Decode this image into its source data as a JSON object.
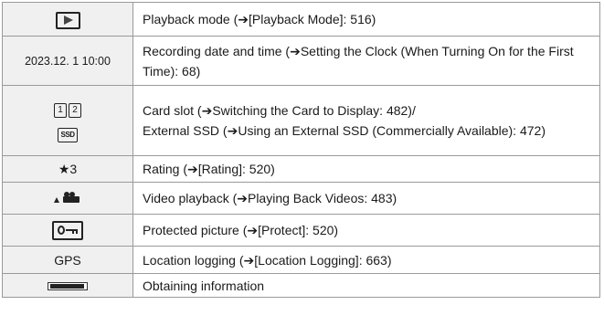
{
  "rows": [
    {
      "icon": "playback-mode-icon",
      "desc_text": "Playback mode (",
      "desc_arrow": "➔",
      "desc_rest": "[Playback Mode]: 516)"
    },
    {
      "icon_text": "2023.12. 1 10:00",
      "desc_text": "Recording date and time (",
      "desc_arrow": "➔",
      "desc_rest": "Setting the Clock (When Turning On for the First Time): 68)"
    },
    {
      "icon_slot1": "1",
      "icon_slot2": "2",
      "icon_ssd": "SSD",
      "desc_line1_text": "Card slot (",
      "desc_line1_arrow": "➔",
      "desc_line1_rest": "Switching the Card to Display: 482)/",
      "desc_line2_text": "External SSD (",
      "desc_line2_arrow": "➔",
      "desc_line2_rest": "Using an External SSD (Commercially Available): 472)"
    },
    {
      "icon_text": "★3",
      "desc_text": "Rating (",
      "desc_arrow": "➔",
      "desc_rest": "[Rating]: 520)"
    },
    {
      "icon": "video-playback-icon",
      "desc_text": "Video playback (",
      "desc_arrow": "➔",
      "desc_rest": "Playing Back Videos: 483)"
    },
    {
      "icon": "protect-icon",
      "desc_text": "Protected picture (",
      "desc_arrow": "➔",
      "desc_rest": "[Protect]: 520)"
    },
    {
      "icon_text": "GPS",
      "desc_text": "Location logging (",
      "desc_arrow": "➔",
      "desc_rest": "[Location Logging]: 663)"
    },
    {
      "icon": "obtaining-information-icon",
      "progress": 0.88,
      "desc_text": "Obtaining information"
    }
  ]
}
